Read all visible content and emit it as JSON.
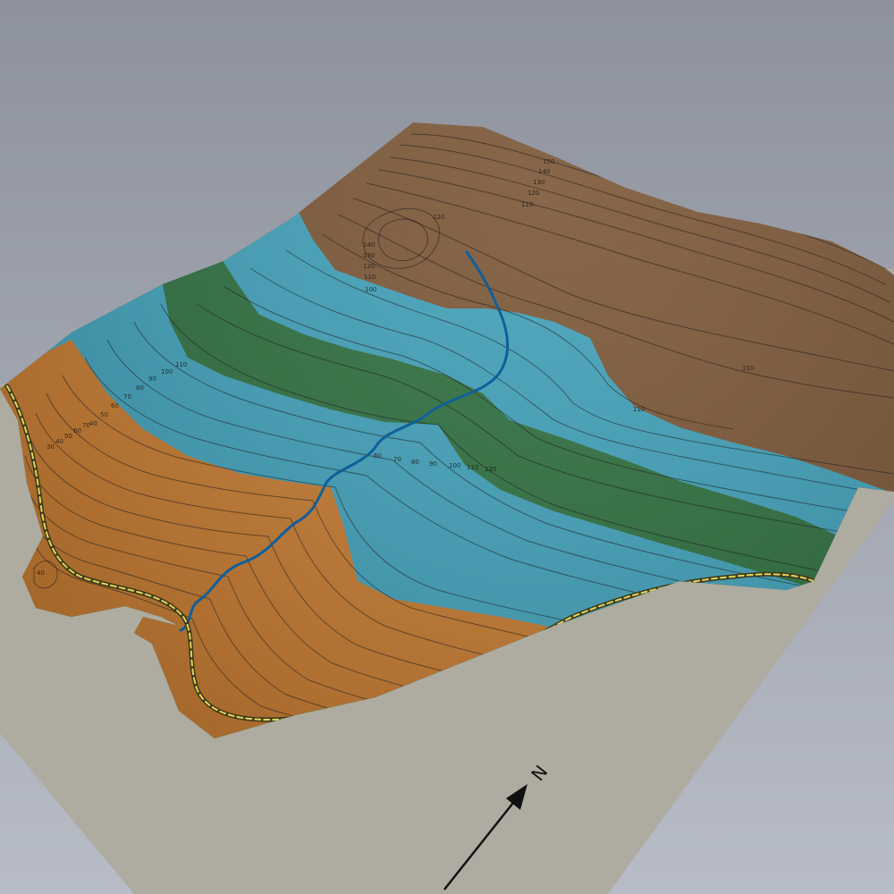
{
  "scene": {
    "colors": {
      "background_top": "#8d929d",
      "background_bottom": "#b7bcc6",
      "base_plane": "#aeaca0",
      "unit_orange": "#c4792f",
      "unit_teal": "#3f9fb8",
      "unit_green": "#2d6e3e",
      "unit_brown": "#7a5535",
      "stream": "#0f5f9a",
      "road_fill": "#e6d35a",
      "road_edge": "#3a3a1a",
      "contour": "#1e1e1e"
    },
    "icons": {
      "north_arrow": "north-arrow-icon"
    }
  },
  "labels": {
    "north": "N",
    "contours_northeast": [
      "160",
      "150",
      "140",
      "130",
      "120",
      "110"
    ],
    "contours_north_peak": [
      "140",
      "130",
      "120",
      "110",
      "100"
    ],
    "contour_peak_side": "120",
    "contour_east_a": "110",
    "contour_east_b": "110",
    "contours_west": [
      "110",
      "100",
      "90",
      "80",
      "70",
      "60",
      "50",
      "40"
    ],
    "contours_south": [
      "30",
      "40",
      "50",
      "60",
      "70",
      "80",
      "90",
      "100"
    ],
    "contours_center": [
      "60",
      "70",
      "80",
      "90",
      "100",
      "110",
      "120"
    ],
    "contour_southwest_small": "40"
  }
}
